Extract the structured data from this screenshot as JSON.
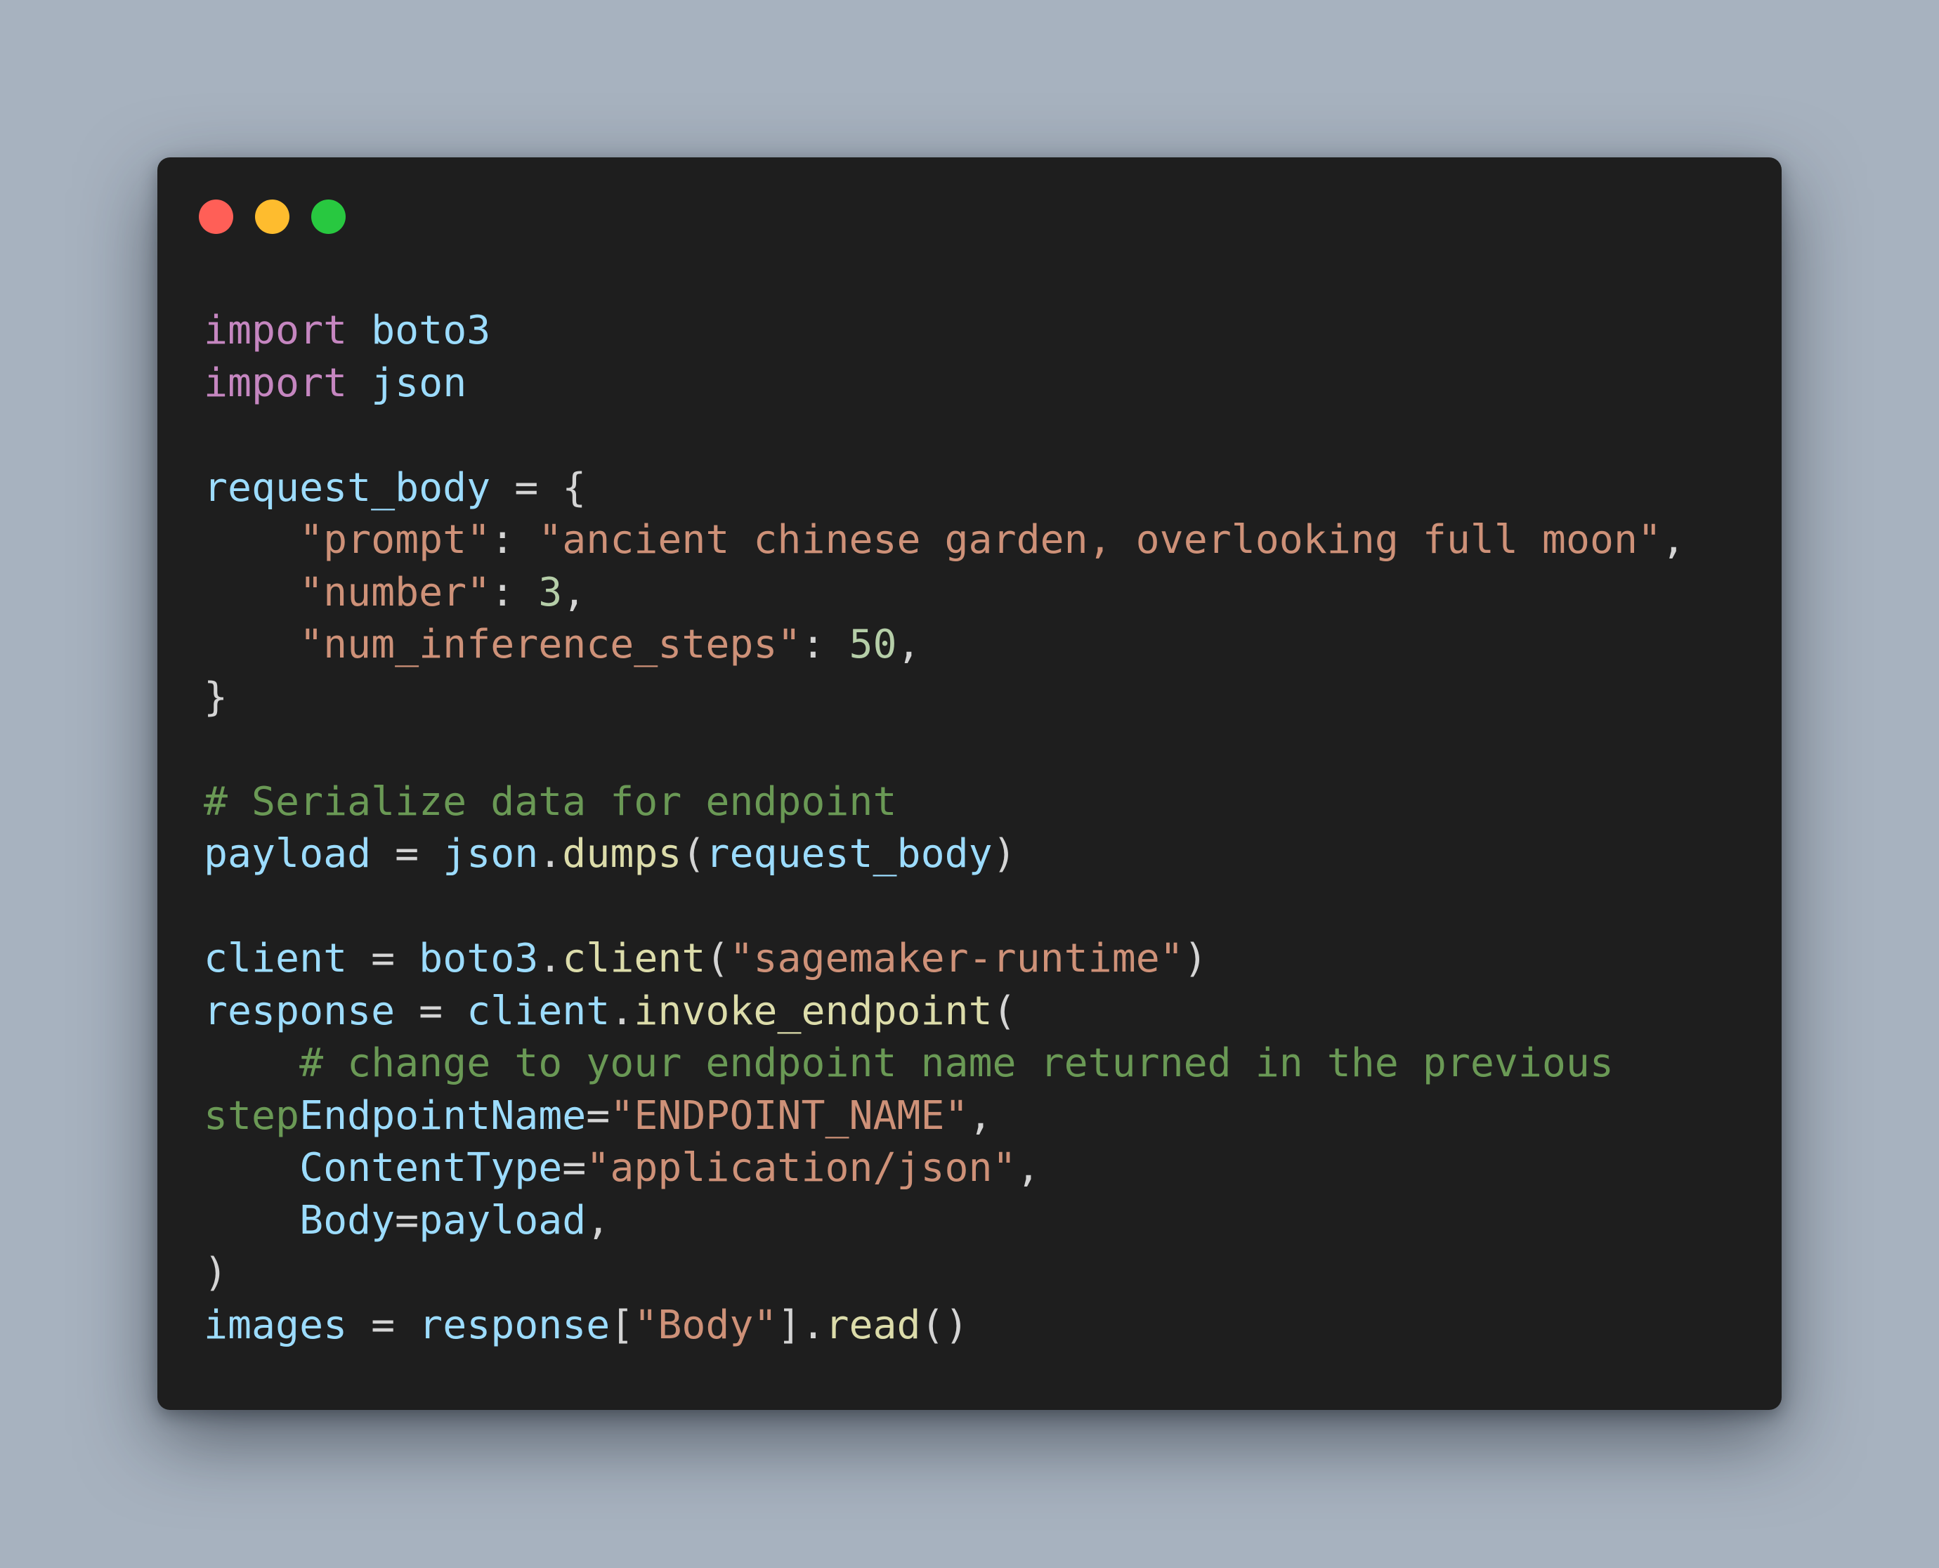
{
  "colors": {
    "page_background": "#a7b2bf",
    "window_background": "#1e1e1e",
    "close_button": "#ff5f57",
    "minimize_button": "#febc2e",
    "maximize_button": "#28c840",
    "keyword": "#c586c0",
    "variable": "#9cdcfe",
    "string": "#ce9178",
    "number": "#b5cea8",
    "function": "#dcdcaa",
    "comment": "#6a9955",
    "punctuation": "#d4d4d4"
  },
  "window_controls": [
    "close",
    "minimize",
    "maximize"
  ],
  "code": {
    "lines": [
      [
        {
          "t": "kw",
          "v": "import"
        },
        {
          "t": "pn",
          "v": " "
        },
        {
          "t": "var",
          "v": "boto3"
        }
      ],
      [
        {
          "t": "kw",
          "v": "import"
        },
        {
          "t": "pn",
          "v": " "
        },
        {
          "t": "var",
          "v": "json"
        }
      ],
      [],
      [
        {
          "t": "var",
          "v": "request_body"
        },
        {
          "t": "pn",
          "v": " = {"
        }
      ],
      [
        {
          "t": "pn",
          "v": "    "
        },
        {
          "t": "str",
          "v": "\"prompt\""
        },
        {
          "t": "pn",
          "v": ": "
        },
        {
          "t": "str",
          "v": "\"ancient chinese garden, overlooking full moon\""
        },
        {
          "t": "pn",
          "v": ","
        }
      ],
      [
        {
          "t": "pn",
          "v": "    "
        },
        {
          "t": "str",
          "v": "\"number\""
        },
        {
          "t": "pn",
          "v": ": "
        },
        {
          "t": "num",
          "v": "3"
        },
        {
          "t": "pn",
          "v": ","
        }
      ],
      [
        {
          "t": "pn",
          "v": "    "
        },
        {
          "t": "str",
          "v": "\"num_inference_steps\""
        },
        {
          "t": "pn",
          "v": ": "
        },
        {
          "t": "num",
          "v": "50"
        },
        {
          "t": "pn",
          "v": ","
        }
      ],
      [
        {
          "t": "pn",
          "v": "}"
        }
      ],
      [],
      [
        {
          "t": "cm",
          "v": "# Serialize data for endpoint"
        }
      ],
      [
        {
          "t": "var",
          "v": "payload"
        },
        {
          "t": "pn",
          "v": " = "
        },
        {
          "t": "var",
          "v": "json"
        },
        {
          "t": "pn",
          "v": "."
        },
        {
          "t": "fn",
          "v": "dumps"
        },
        {
          "t": "pn",
          "v": "("
        },
        {
          "t": "var",
          "v": "request_body"
        },
        {
          "t": "pn",
          "v": ")"
        }
      ],
      [],
      [
        {
          "t": "var",
          "v": "client"
        },
        {
          "t": "pn",
          "v": " = "
        },
        {
          "t": "var",
          "v": "boto3"
        },
        {
          "t": "pn",
          "v": "."
        },
        {
          "t": "fn",
          "v": "client"
        },
        {
          "t": "pn",
          "v": "("
        },
        {
          "t": "str",
          "v": "\"sagemaker-runtime\""
        },
        {
          "t": "pn",
          "v": ")"
        }
      ],
      [
        {
          "t": "var",
          "v": "response"
        },
        {
          "t": "pn",
          "v": " = "
        },
        {
          "t": "var",
          "v": "client"
        },
        {
          "t": "pn",
          "v": "."
        },
        {
          "t": "fn",
          "v": "invoke_endpoint"
        },
        {
          "t": "pn",
          "v": "("
        }
      ],
      [
        {
          "t": "pn",
          "v": "    "
        },
        {
          "t": "cm",
          "v": "# change to your endpoint name returned in the previous"
        }
      ],
      [
        {
          "t": "cm",
          "v": "step"
        },
        {
          "t": "var",
          "v": "EndpointName"
        },
        {
          "t": "pn",
          "v": "="
        },
        {
          "t": "str",
          "v": "\"ENDPOINT_NAME\""
        },
        {
          "t": "pn",
          "v": ","
        }
      ],
      [
        {
          "t": "pn",
          "v": "    "
        },
        {
          "t": "var",
          "v": "ContentType"
        },
        {
          "t": "pn",
          "v": "="
        },
        {
          "t": "str",
          "v": "\"application/json\""
        },
        {
          "t": "pn",
          "v": ","
        }
      ],
      [
        {
          "t": "pn",
          "v": "    "
        },
        {
          "t": "var",
          "v": "Body"
        },
        {
          "t": "pn",
          "v": "="
        },
        {
          "t": "var",
          "v": "payload"
        },
        {
          "t": "pn",
          "v": ","
        }
      ],
      [
        {
          "t": "pn",
          "v": ")"
        }
      ],
      [
        {
          "t": "var",
          "v": "images"
        },
        {
          "t": "pn",
          "v": " = "
        },
        {
          "t": "var",
          "v": "response"
        },
        {
          "t": "pn",
          "v": "["
        },
        {
          "t": "str",
          "v": "\"Body\""
        },
        {
          "t": "pn",
          "v": "]."
        },
        {
          "t": "fn",
          "v": "read"
        },
        {
          "t": "pn",
          "v": "()"
        }
      ]
    ]
  }
}
